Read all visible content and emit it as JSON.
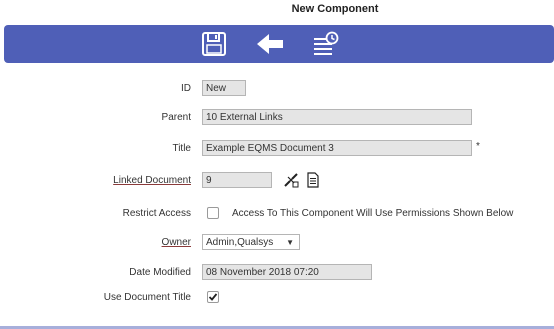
{
  "header": {
    "title": "New Component"
  },
  "toolbar": {
    "save_icon": "save-icon",
    "back_icon": "back-arrow-icon",
    "history_icon": "history-icon",
    "color": "#4f5fb7"
  },
  "form": {
    "id": {
      "label": "ID",
      "value": "New"
    },
    "parent": {
      "label": "Parent",
      "value": "10 External Links"
    },
    "title": {
      "label": "Title",
      "value": "Example EQMS Document 3",
      "required_marker": "*"
    },
    "linked_document": {
      "label": "Linked Document",
      "value": "9"
    },
    "restrict_access": {
      "label": "Restrict Access",
      "checked": false,
      "text": "Access To This Component Will Use Permissions Shown Below"
    },
    "owner": {
      "label": "Owner",
      "value": "Admin,Qualsys"
    },
    "date_modified": {
      "label": "Date Modified",
      "value": "08 November 2018 07:20"
    },
    "use_document_title": {
      "label": "Use Document Title",
      "checked": true
    }
  }
}
